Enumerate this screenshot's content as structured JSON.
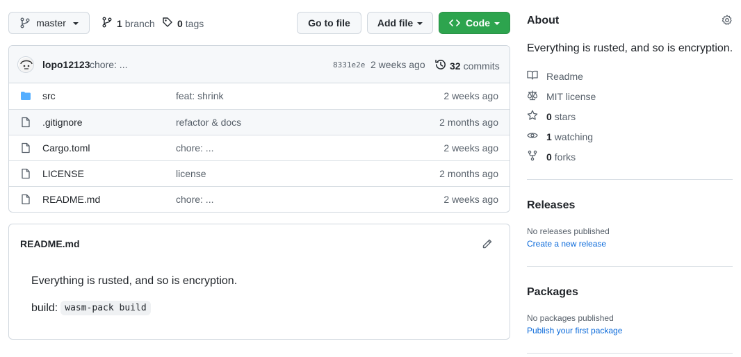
{
  "toolbar": {
    "branch_label": "master",
    "branches_count": "1",
    "branches_label": "branch",
    "tags_count": "0",
    "tags_label": "tags",
    "go_to_file": "Go to file",
    "add_file": "Add file",
    "code": "Code"
  },
  "commit": {
    "author": "lopo12123",
    "message": "chore: ...",
    "sha": "8331e2e",
    "age": "2 weeks ago",
    "commits_count": "32",
    "commits_label": "commits"
  },
  "files": [
    {
      "name": "src",
      "type": "folder",
      "message": "feat: shrink",
      "age": "2 weeks ago"
    },
    {
      "name": ".gitignore",
      "type": "file",
      "message": "refactor & docs",
      "age": "2 months ago"
    },
    {
      "name": "Cargo.toml",
      "type": "file",
      "message": "chore: ...",
      "age": "2 weeks ago"
    },
    {
      "name": "LICENSE",
      "type": "file",
      "message": "license",
      "age": "2 months ago"
    },
    {
      "name": "README.md",
      "type": "file",
      "message": "chore: ...",
      "age": "2 weeks ago"
    }
  ],
  "readme": {
    "title": "README.md",
    "body": "Everything is rusted, and so is encryption.",
    "build_label": "build:",
    "build_code": "wasm-pack build"
  },
  "about": {
    "heading": "About",
    "description": "Everything is rusted, and so is encryption.",
    "readme": "Readme",
    "license": "MIT license",
    "stars_count": "0",
    "stars_label": "stars",
    "watching_count": "1",
    "watching_label": "watching",
    "forks_count": "0",
    "forks_label": "forks"
  },
  "releases": {
    "heading": "Releases",
    "empty": "No releases published",
    "link": "Create a new release"
  },
  "packages": {
    "heading": "Packages",
    "empty": "No packages published",
    "link": "Publish your first package"
  },
  "colors": {
    "accent_green": "#2da44e",
    "link_blue": "#0969da",
    "folder_blue": "#54aeff",
    "border": "#d0d7de"
  }
}
